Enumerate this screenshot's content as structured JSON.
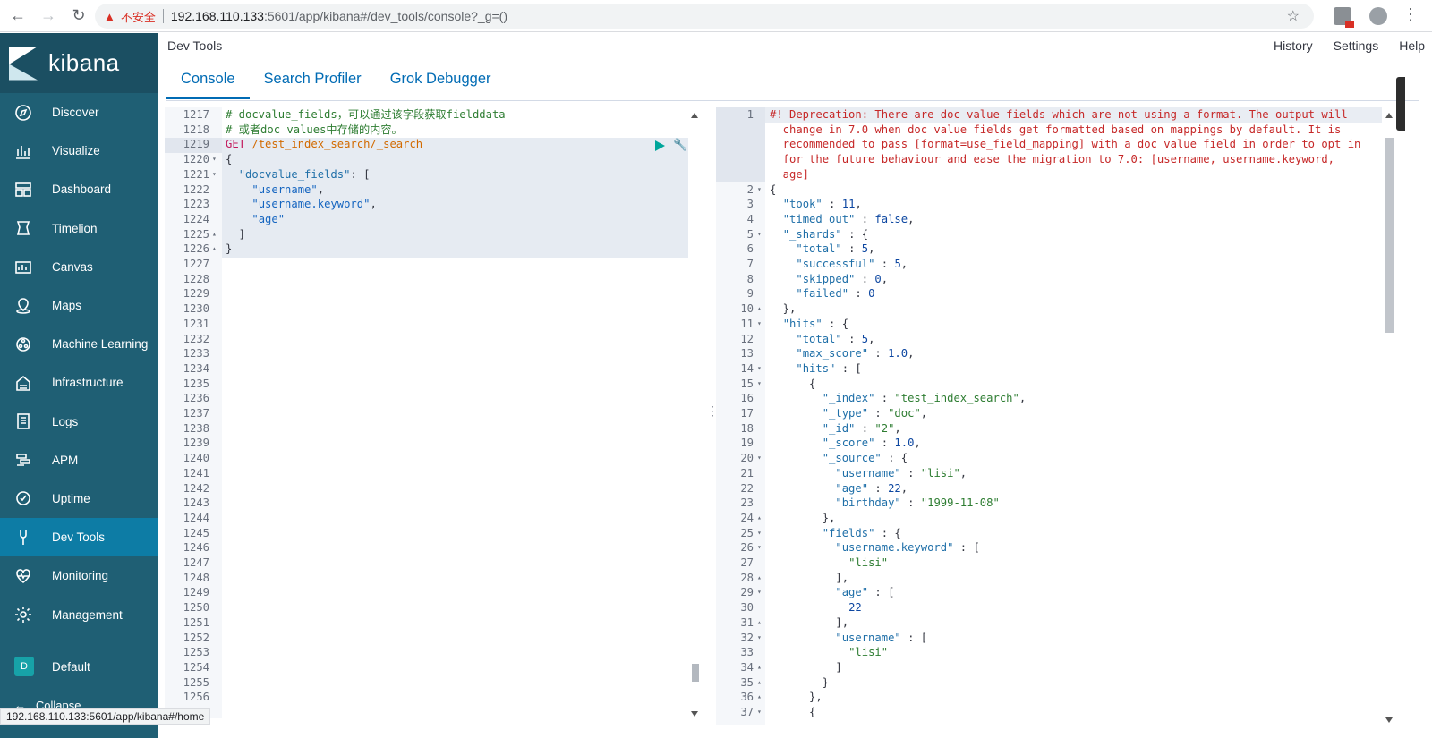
{
  "browser": {
    "insecure_label": "不安全",
    "url_host": "192.168.110.133",
    "url_path": ":5601/app/kibana#/dev_tools/console?_g=()",
    "status_url": "192.168.110.133:5601/app/kibana#/home"
  },
  "sidebar": {
    "brand": "kibana",
    "items": [
      {
        "label": "Discover",
        "icon": "compass-icon"
      },
      {
        "label": "Visualize",
        "icon": "chart-icon"
      },
      {
        "label": "Dashboard",
        "icon": "dashboard-icon"
      },
      {
        "label": "Timelion",
        "icon": "timelion-icon"
      },
      {
        "label": "Canvas",
        "icon": "canvas-icon"
      },
      {
        "label": "Maps",
        "icon": "maps-icon"
      },
      {
        "label": "Machine Learning",
        "icon": "ml-icon"
      },
      {
        "label": "Infrastructure",
        "icon": "infra-icon"
      },
      {
        "label": "Logs",
        "icon": "logs-icon"
      },
      {
        "label": "APM",
        "icon": "apm-icon"
      },
      {
        "label": "Uptime",
        "icon": "uptime-icon"
      },
      {
        "label": "Dev Tools",
        "icon": "wrench-icon"
      },
      {
        "label": "Monitoring",
        "icon": "heartbeat-icon"
      },
      {
        "label": "Management",
        "icon": "gear-icon"
      }
    ],
    "space_badge": "D",
    "space_label": "Default",
    "collapse_label": "Collapse"
  },
  "header": {
    "title": "Dev Tools",
    "links": [
      "History",
      "Settings",
      "Help"
    ]
  },
  "tabs": [
    "Console",
    "Search Profiler",
    "Grok Debugger"
  ],
  "colors": {
    "sidebar": "#1f5f74",
    "active": "#0d7ca5",
    "accent": "#006bb4"
  },
  "request_editor": {
    "lines": [
      {
        "n": "1217",
        "html": "<span class='comment'># docvalue_fields，可以通过该字段获取fielddata</span>"
      },
      {
        "n": "1218",
        "html": "<span class='comment'># 或者doc values中存储的内容。</span>"
      },
      {
        "n": "1219",
        "html": "<span class='kw'>GET</span> <span class='path'>/test_index_search/_search</span>"
      },
      {
        "n": "1220",
        "fold": "▾",
        "html": "{"
      },
      {
        "n": "1221",
        "fold": "▾",
        "html": "  <span class='key'>\"docvalue_fields\"</span>: ["
      },
      {
        "n": "1222",
        "html": "    <span class='str'>\"username\"</span>,"
      },
      {
        "n": "1223",
        "html": "    <span class='str'>\"username.keyword\"</span>,"
      },
      {
        "n": "1224",
        "html": "    <span class='str'>\"age\"</span>"
      },
      {
        "n": "1225",
        "fold": "▴",
        "html": "  ]"
      },
      {
        "n": "1226",
        "fold": "▴",
        "html": "}"
      },
      {
        "n": "1227",
        "html": ""
      },
      {
        "n": "1228",
        "html": ""
      },
      {
        "n": "1229",
        "html": ""
      },
      {
        "n": "1230",
        "html": ""
      },
      {
        "n": "1231",
        "html": ""
      },
      {
        "n": "1232",
        "html": ""
      },
      {
        "n": "1233",
        "html": ""
      },
      {
        "n": "1234",
        "html": ""
      },
      {
        "n": "1235",
        "html": ""
      },
      {
        "n": "1236",
        "html": ""
      },
      {
        "n": "1237",
        "html": ""
      },
      {
        "n": "1238",
        "html": ""
      },
      {
        "n": "1239",
        "html": ""
      },
      {
        "n": "1240",
        "html": ""
      },
      {
        "n": "1241",
        "html": ""
      },
      {
        "n": "1242",
        "html": ""
      },
      {
        "n": "1243",
        "html": ""
      },
      {
        "n": "1244",
        "html": ""
      },
      {
        "n": "1245",
        "html": ""
      },
      {
        "n": "1246",
        "html": ""
      },
      {
        "n": "1247",
        "html": ""
      },
      {
        "n": "1248",
        "html": ""
      },
      {
        "n": "1249",
        "html": ""
      },
      {
        "n": "1250",
        "html": ""
      },
      {
        "n": "1251",
        "html": ""
      },
      {
        "n": "1252",
        "html": ""
      },
      {
        "n": "1253",
        "html": ""
      },
      {
        "n": "1254",
        "html": ""
      },
      {
        "n": "1255",
        "html": ""
      },
      {
        "n": "1256",
        "html": ""
      }
    ]
  },
  "response_editor": {
    "lines": [
      {
        "n": "1",
        "html": "<span class='err'>#! Deprecation: There are doc-value fields which are not using a format. The output will</span>"
      },
      {
        "n": "",
        "html": "<span class='err'>  change in 7.0 when doc value fields get formatted based on mappings by default. It is</span>"
      },
      {
        "n": "",
        "html": "<span class='err'>  recommended to pass [format=use_field_mapping] with a doc value field in order to opt in</span>"
      },
      {
        "n": "",
        "html": "<span class='err'>  for the future behaviour and ease the migration to 7.0: [username, username.keyword,</span>"
      },
      {
        "n": "",
        "html": "<span class='err'>  age]</span>"
      },
      {
        "n": "2",
        "fold": "▾",
        "html": "{"
      },
      {
        "n": "3",
        "html": "  <span class='key'>\"took\"</span> : <span class='num'>11</span>,"
      },
      {
        "n": "4",
        "html": "  <span class='key'>\"timed_out\"</span> : <span class='bool'>false</span>,"
      },
      {
        "n": "5",
        "fold": "▾",
        "html": "  <span class='key'>\"_shards\"</span> : {"
      },
      {
        "n": "6",
        "html": "    <span class='key'>\"total\"</span> : <span class='num'>5</span>,"
      },
      {
        "n": "7",
        "html": "    <span class='key'>\"successful\"</span> : <span class='num'>5</span>,"
      },
      {
        "n": "8",
        "html": "    <span class='key'>\"skipped\"</span> : <span class='num'>0</span>,"
      },
      {
        "n": "9",
        "html": "    <span class='key'>\"failed\"</span> : <span class='num'>0</span>"
      },
      {
        "n": "10",
        "fold": "▴",
        "html": "  },"
      },
      {
        "n": "11",
        "fold": "▾",
        "html": "  <span class='key'>\"hits\"</span> : {"
      },
      {
        "n": "12",
        "html": "    <span class='key'>\"total\"</span> : <span class='num'>5</span>,"
      },
      {
        "n": "13",
        "html": "    <span class='key'>\"max_score\"</span> : <span class='num'>1.0</span>,"
      },
      {
        "n": "14",
        "fold": "▾",
        "html": "    <span class='key'>\"hits\"</span> : ["
      },
      {
        "n": "15",
        "fold": "▾",
        "html": "      {"
      },
      {
        "n": "16",
        "html": "        <span class='key'>\"_index\"</span> : <span class='comment'>\"test_index_search\"</span>,"
      },
      {
        "n": "17",
        "html": "        <span class='key'>\"_type\"</span> : <span class='comment'>\"doc\"</span>,"
      },
      {
        "n": "18",
        "html": "        <span class='key'>\"_id\"</span> : <span class='comment'>\"2\"</span>,"
      },
      {
        "n": "19",
        "html": "        <span class='key'>\"_score\"</span> : <span class='num'>1.0</span>,"
      },
      {
        "n": "20",
        "fold": "▾",
        "html": "        <span class='key'>\"_source\"</span> : {"
      },
      {
        "n": "21",
        "html": "          <span class='key'>\"username\"</span> : <span class='comment'>\"lisi\"</span>,"
      },
      {
        "n": "22",
        "html": "          <span class='key'>\"age\"</span> : <span class='num'>22</span>,"
      },
      {
        "n": "23",
        "html": "          <span class='key'>\"birthday\"</span> : <span class='comment'>\"1999-11-08\"</span>"
      },
      {
        "n": "24",
        "fold": "▴",
        "html": "        },"
      },
      {
        "n": "25",
        "fold": "▾",
        "html": "        <span class='key'>\"fields\"</span> : {"
      },
      {
        "n": "26",
        "fold": "▾",
        "html": "          <span class='key'>\"username.keyword\"</span> : ["
      },
      {
        "n": "27",
        "html": "            <span class='comment'>\"lisi\"</span>"
      },
      {
        "n": "28",
        "fold": "▴",
        "html": "          ],"
      },
      {
        "n": "29",
        "fold": "▾",
        "html": "          <span class='key'>\"age\"</span> : ["
      },
      {
        "n": "30",
        "html": "            <span class='num'>22</span>"
      },
      {
        "n": "31",
        "fold": "▴",
        "html": "          ],"
      },
      {
        "n": "32",
        "fold": "▾",
        "html": "          <span class='key'>\"username\"</span> : ["
      },
      {
        "n": "33",
        "html": "            <span class='comment'>\"lisi\"</span>"
      },
      {
        "n": "34",
        "fold": "▴",
        "html": "          ]"
      },
      {
        "n": "35",
        "fold": "▴",
        "html": "        }"
      },
      {
        "n": "36",
        "fold": "▴",
        "html": "      },"
      },
      {
        "n": "37",
        "fold": "▾",
        "html": "      {"
      }
    ]
  }
}
